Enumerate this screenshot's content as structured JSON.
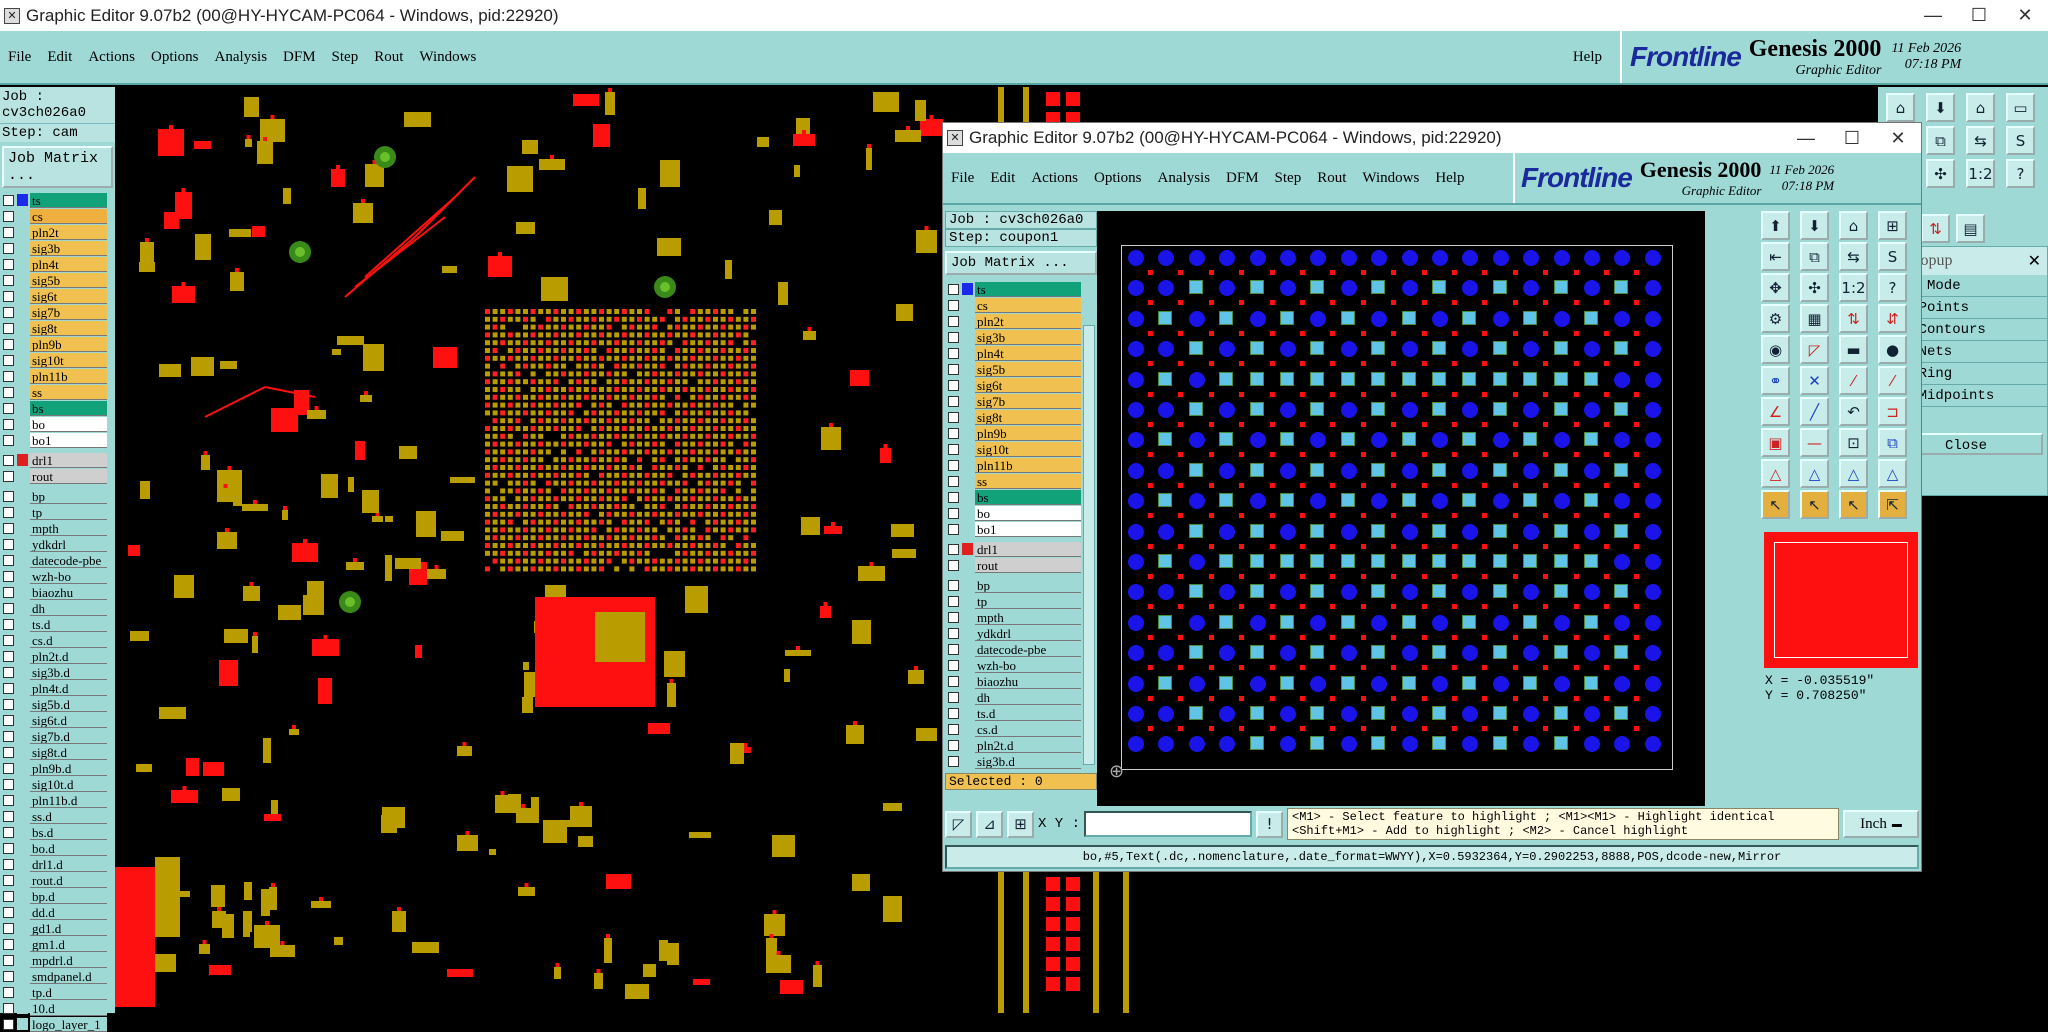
{
  "main_window": {
    "title": "Graphic Editor 9.07b2 (00@HY-HYCAM-PC064 - Windows, pid:22920)",
    "menu": [
      "File",
      "Edit",
      "Actions",
      "Options",
      "Analysis",
      "DFM",
      "Step",
      "Rout",
      "Windows"
    ],
    "help": "Help",
    "brand": "Frontline",
    "product": "Genesis 2000",
    "product_sub": "Graphic Editor",
    "date": "11 Feb 2026",
    "time": "07:18 PM",
    "job": "Job : cv3ch026a0",
    "step": "Step: cam",
    "job_matrix": "Job Matrix ...",
    "layers_top": [
      {
        "name": "ts",
        "color": "#12a27a"
      },
      {
        "name": "cs",
        "color": "#f0b040"
      },
      {
        "name": "pln2t",
        "color": "#f0c050"
      },
      {
        "name": "sig3b",
        "color": "#f0c050"
      },
      {
        "name": "pln4t",
        "color": "#f0c050"
      },
      {
        "name": "sig5b",
        "color": "#f0c050"
      },
      {
        "name": "sig6t",
        "color": "#f0c050"
      },
      {
        "name": "sig7b",
        "color": "#f0c050"
      },
      {
        "name": "sig8t",
        "color": "#f0c050"
      },
      {
        "name": "pln9b",
        "color": "#f0c050"
      },
      {
        "name": "sig10t",
        "color": "#f0c050"
      },
      {
        "name": "pln11b",
        "color": "#f0c050"
      },
      {
        "name": "ss",
        "color": "#f0c050"
      },
      {
        "name": "bs",
        "color": "#12a27a"
      },
      {
        "name": "bo",
        "color": "#ffffff"
      },
      {
        "name": "bo1",
        "color": "#ffffff"
      }
    ],
    "layers_drill": [
      {
        "name": "drl1",
        "color": "#cfcfcf"
      },
      {
        "name": "rout",
        "color": "#cfcfcf"
      }
    ],
    "layers_misc": [
      "bp",
      "tp",
      "mpth",
      "ydkdrl",
      "datecode-pbe",
      "wzh-bo",
      "biaozhu",
      "dh",
      "ts.d",
      "cs.d",
      "pln2t.d",
      "sig3b.d",
      "pln4t.d",
      "sig5b.d",
      "sig6t.d",
      "sig7b.d",
      "sig8t.d",
      "pln9b.d",
      "sig10t.d",
      "pln11b.d",
      "ss.d",
      "bs.d",
      "bo.d",
      "drl1.d",
      "rout.d",
      "bp.d",
      "dd.d",
      "gd1.d",
      "gm1.d",
      "mpdrl.d",
      "smdpanel.d",
      "tp.d",
      "10.d",
      "logo_layer_1"
    ]
  },
  "second_window": {
    "title": "Graphic Editor 9.07b2 (00@HY-HYCAM-PC064 - Windows, pid:22920)",
    "menu": [
      "File",
      "Edit",
      "Actions",
      "Options",
      "Analysis",
      "DFM",
      "Step",
      "Rout",
      "Windows",
      "Help"
    ],
    "brand": "Frontline",
    "product": "Genesis 2000",
    "product_sub": "Graphic Editor",
    "date": "11 Feb 2026",
    "time": "07:18 PM",
    "job": "Job : cv3ch026a0",
    "step": "Step: coupon1",
    "job_matrix": "Job Matrix ...",
    "layers_top": [
      {
        "name": "ts",
        "color": "#12a27a"
      },
      {
        "name": "cs",
        "color": "#f0c050"
      },
      {
        "name": "pln2t",
        "color": "#f0c050"
      },
      {
        "name": "sig3b",
        "color": "#f0c050"
      },
      {
        "name": "pln4t",
        "color": "#f0c050"
      },
      {
        "name": "sig5b",
        "color": "#f0c050"
      },
      {
        "name": "sig6t",
        "color": "#f0c050"
      },
      {
        "name": "sig7b",
        "color": "#f0c050"
      },
      {
        "name": "sig8t",
        "color": "#f0c050"
      },
      {
        "name": "pln9b",
        "color": "#f0c050"
      },
      {
        "name": "sig10t",
        "color": "#f0c050"
      },
      {
        "name": "pln11b",
        "color": "#f0c050"
      },
      {
        "name": "ss",
        "color": "#f0c050"
      },
      {
        "name": "bs",
        "color": "#12a27a"
      },
      {
        "name": "bo",
        "color": "#ffffff"
      },
      {
        "name": "bo1",
        "color": "#ffffff"
      }
    ],
    "layers_drill": [
      {
        "name": "drl1",
        "color": "#cfcfcf"
      },
      {
        "name": "rout",
        "color": "#cfcfcf"
      }
    ],
    "layers_misc": [
      "bp",
      "tp",
      "mpth",
      "ydkdrl",
      "datecode-pbe",
      "wzh-bo",
      "biaozhu",
      "dh",
      "ts.d",
      "cs.d",
      "pln2t.d",
      "sig3b.d"
    ],
    "selected": "Selected : 0",
    "xy_label": "X Y :",
    "xy_value": "",
    "hint_line1": "<M1> - Select feature to highlight ; <M1><M1> - Highlight identical",
    "hint_line2": "<Shift+M1> - Add to highlight ; <M2> - Cancel highlight",
    "units": "Inch",
    "coord_x": "X = -0.035519\"",
    "coord_y": "Y =  0.708250\"",
    "status": "bo,#5,Text(.dc,.nomenclature,.date_format=WWYY),X=0.5932364,Y=0.2902253,8888,POS,dcode-new,Mirror"
  },
  "measure_popup": {
    "title": "sure Popup",
    "items": [
      "sure Mode",
      "een Points",
      "een Contours",
      "een Nets",
      "lar Ring",
      "een Midpoints"
    ],
    "close": "Close"
  }
}
